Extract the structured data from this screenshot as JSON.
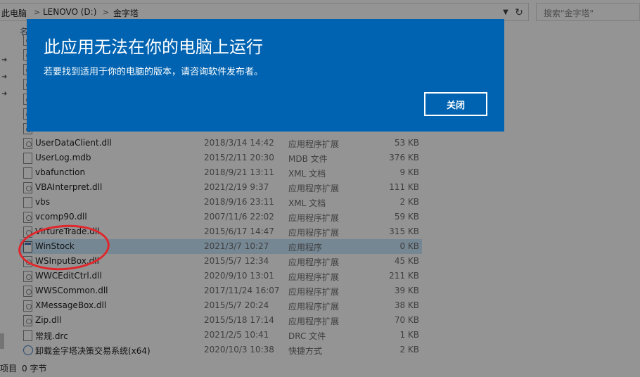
{
  "address": {
    "crumbs": [
      "此电脑",
      "LENOVO (D:)",
      "金字塔"
    ],
    "separator": ">"
  },
  "search": {
    "placeholder": "搜索\"金字塔\""
  },
  "columns": {
    "name": "名"
  },
  "files": [
    {
      "name": "",
      "date": "",
      "type": "",
      "size": "",
      "icon": "dll-icon"
    },
    {
      "name": "",
      "date": "",
      "type": "",
      "size": "",
      "icon": "dll-icon"
    },
    {
      "name": "",
      "date": "",
      "type": "",
      "size": "",
      "icon": "dll-icon"
    },
    {
      "name": "",
      "date": "",
      "type": "",
      "size": "",
      "icon": "dll-icon"
    },
    {
      "name": "",
      "date": "",
      "type": "",
      "size": "",
      "icon": "dll-icon"
    },
    {
      "name": "",
      "date": "",
      "type": "",
      "size": "",
      "icon": "dll-icon"
    },
    {
      "name": "",
      "date": "",
      "type": "",
      "size": "",
      "icon": "dll-icon"
    },
    {
      "name": "UserDataClient.dll",
      "date": "2018/3/14 14:42",
      "type": "应用程序扩展",
      "size": "53 KB",
      "icon": "dll-icon"
    },
    {
      "name": "UserLog.mdb",
      "date": "2015/2/11 20:30",
      "type": "MDB 文件",
      "size": "376 KB",
      "icon": "file-icon"
    },
    {
      "name": "vbafunction",
      "date": "2018/9/21 13:11",
      "type": "XML 文档",
      "size": "9 KB",
      "icon": "file-icon"
    },
    {
      "name": "VBAInterpret.dll",
      "date": "2021/2/19 9:37",
      "type": "应用程序扩展",
      "size": "111 KB",
      "icon": "dll-icon"
    },
    {
      "name": "vbs",
      "date": "2018/9/16 23:11",
      "type": "XML 文档",
      "size": "2 KB",
      "icon": "file-icon"
    },
    {
      "name": "vcomp90.dll",
      "date": "2007/11/6 22:02",
      "type": "应用程序扩展",
      "size": "59 KB",
      "icon": "dll-icon"
    },
    {
      "name": "VirtureTrade.dll",
      "date": "2015/6/17 14:47",
      "type": "应用程序扩展",
      "size": "315 KB",
      "icon": "dll-icon"
    },
    {
      "name": "WinStock",
      "date": "2021/3/7 10:27",
      "type": "应用程序",
      "size": "0 KB",
      "icon": "app-icon",
      "selected": true
    },
    {
      "name": "WSInputBox.dll",
      "date": "2015/5/7 12:34",
      "type": "应用程序扩展",
      "size": "45 KB",
      "icon": "dll-icon"
    },
    {
      "name": "WWCEditCtrl.dll",
      "date": "2020/9/10 13:01",
      "type": "应用程序扩展",
      "size": "211 KB",
      "icon": "dll-icon"
    },
    {
      "name": "WWSCommon.dll",
      "date": "2017/11/24 16:07",
      "type": "应用程序扩展",
      "size": "39 KB",
      "icon": "dll-icon"
    },
    {
      "name": "XMessageBox.dll",
      "date": "2015/5/7 20:24",
      "type": "应用程序扩展",
      "size": "38 KB",
      "icon": "dll-icon"
    },
    {
      "name": "Zip.dll",
      "date": "2015/5/18 17:14",
      "type": "应用程序扩展",
      "size": "70 KB",
      "icon": "dll-icon"
    },
    {
      "name": "常规.drc",
      "date": "2021/2/5 10:41",
      "type": "DRC 文件",
      "size": "1 KB",
      "icon": "file-icon"
    },
    {
      "name": "卸载金字塔决策交易系统(x64)",
      "date": "2020/10/3 10:38",
      "type": "快捷方式",
      "size": "2 KB",
      "icon": "shortcut-icon"
    }
  ],
  "status": {
    "items": "项目",
    "selected": "0 字节"
  },
  "dialog": {
    "title": "此应用无法在你的电脑上运行",
    "message": "若要找到适用于你的电脑的版本，请咨询软件发布者。",
    "close_label": "关闭"
  },
  "colors": {
    "dialog_bg": "#0063b1",
    "annotation": "#e0262b"
  }
}
